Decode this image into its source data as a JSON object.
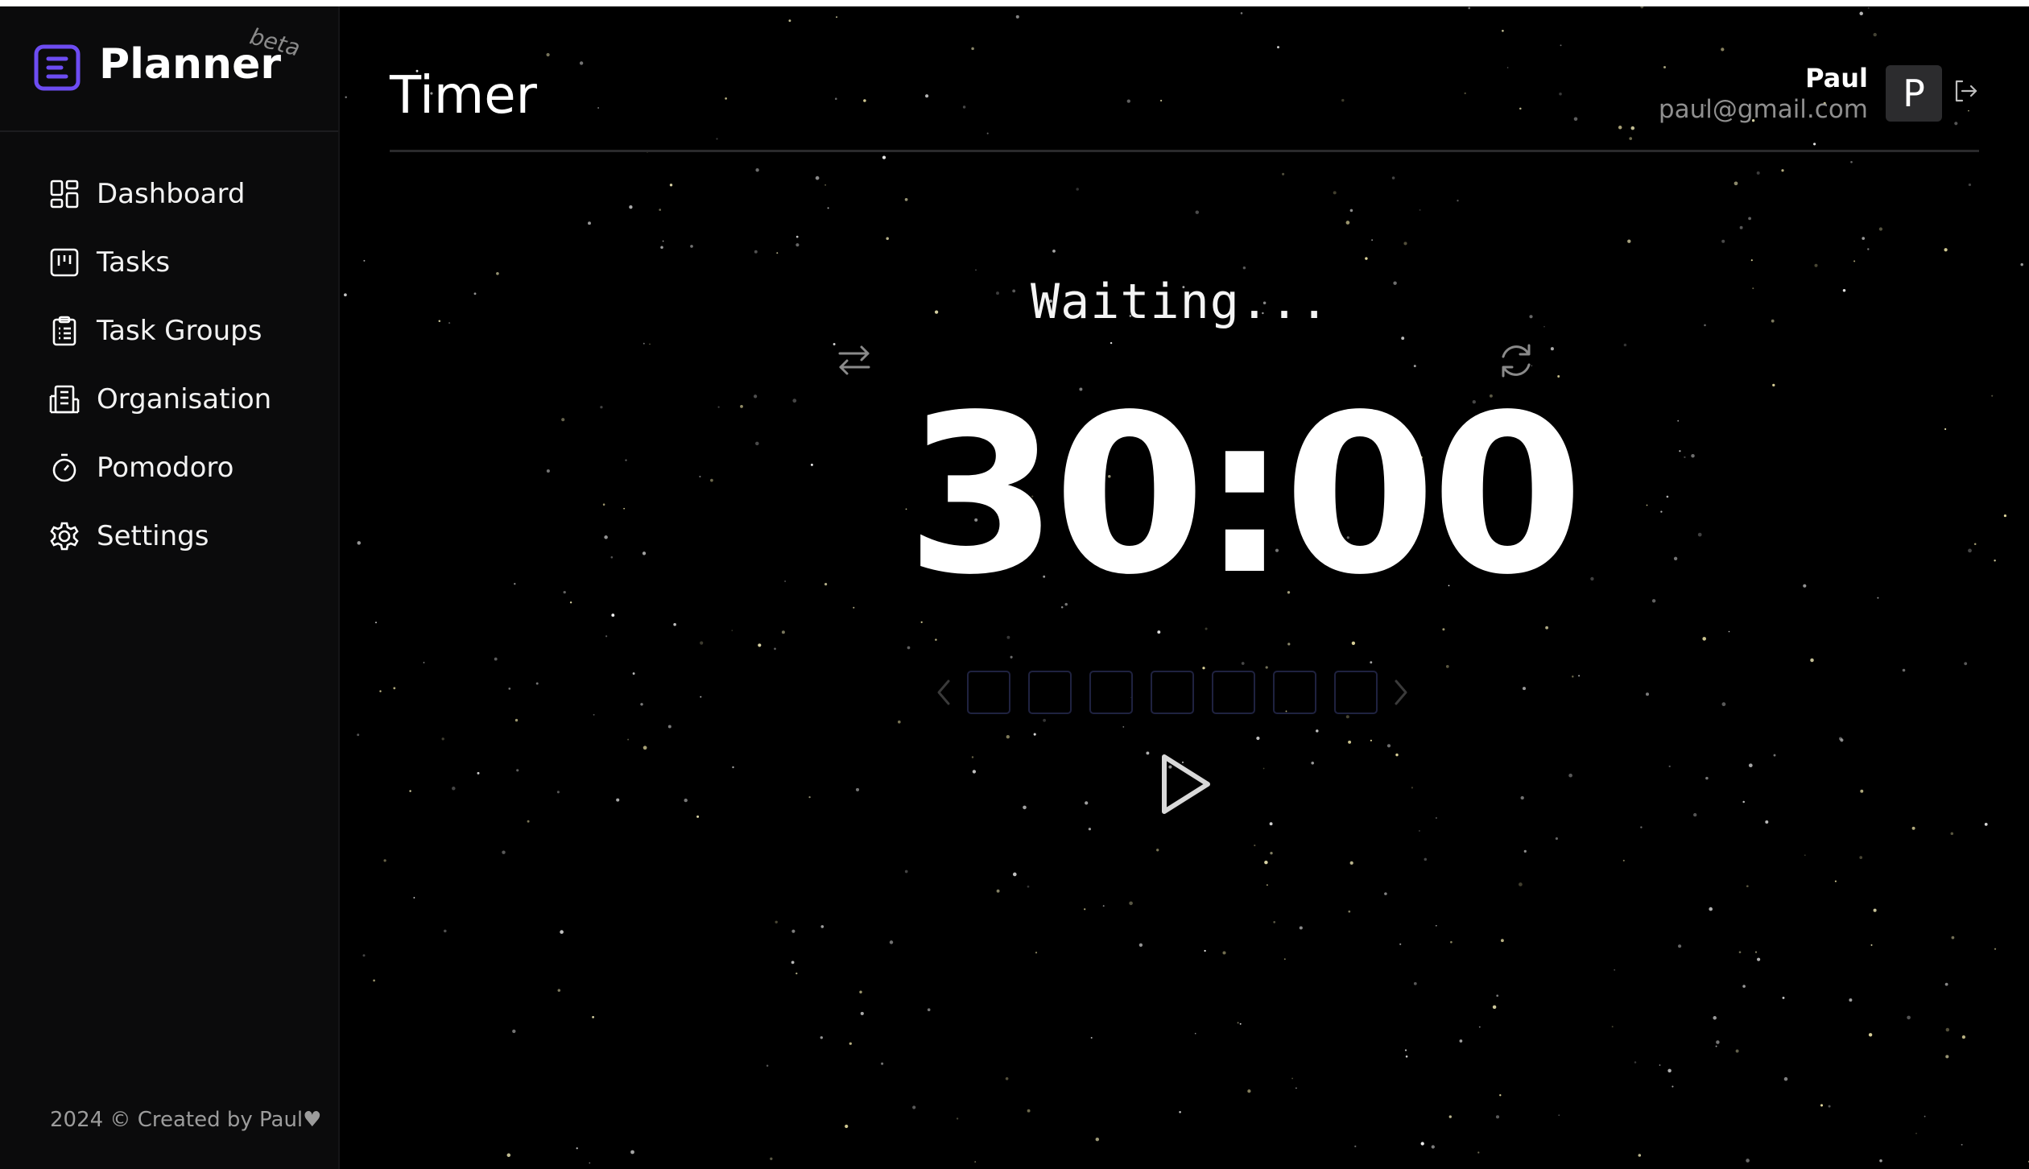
{
  "app": {
    "name": "Planner",
    "badge": "beta",
    "accent_color": "#6d4cf2"
  },
  "sidebar": {
    "items": [
      {
        "label": "Dashboard",
        "icon": "dashboard-icon"
      },
      {
        "label": "Tasks",
        "icon": "kanban-icon"
      },
      {
        "label": "Task Groups",
        "icon": "clipboard-icon"
      },
      {
        "label": "Organisation",
        "icon": "building-icon"
      },
      {
        "label": "Pomodoro",
        "icon": "stopwatch-icon"
      },
      {
        "label": "Settings",
        "icon": "gear-icon"
      }
    ],
    "footer": "2024 © Created by Paul♥"
  },
  "header": {
    "title": "Timer",
    "user": {
      "name": "Paul",
      "email": "paul@gmail.com",
      "avatar_initial": "P"
    }
  },
  "timer": {
    "status": "Waiting...",
    "time": "30:00",
    "session_slots": 7,
    "controls": [
      "swap-icon",
      "reset-icon",
      "play-icon",
      "chevron-left-icon",
      "chevron-right-icon"
    ]
  },
  "colors": {
    "background": "#000000",
    "sidebar": "#0b0b0c",
    "session_box_border": "#1f2240"
  }
}
